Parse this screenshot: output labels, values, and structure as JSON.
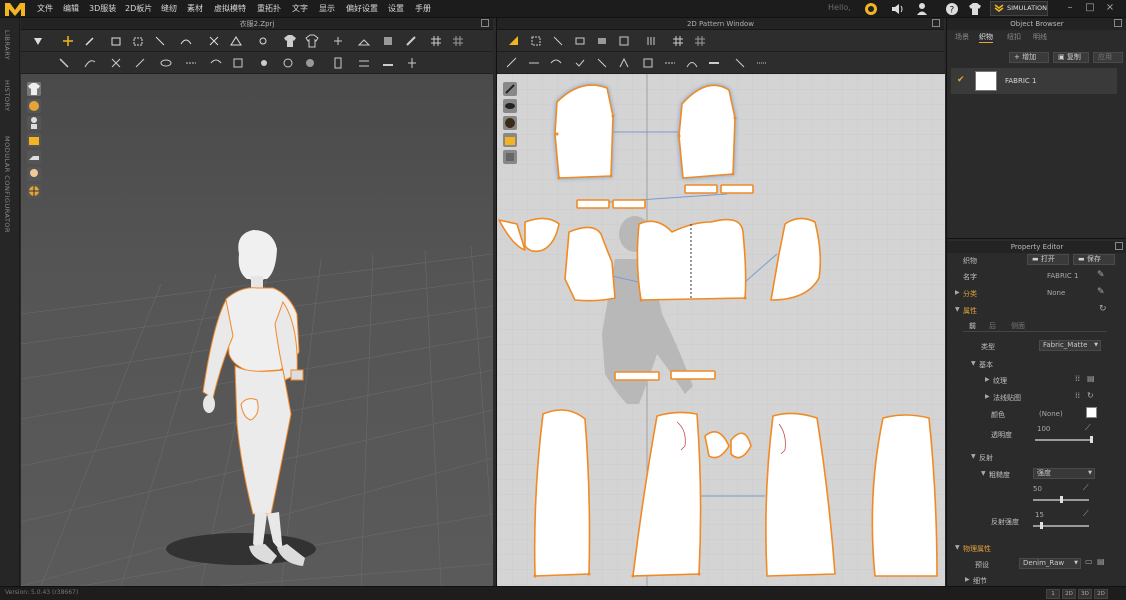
{
  "menubar": {
    "items": [
      "文件",
      "编辑",
      "3D服装",
      "2D板片",
      "缝纫",
      "素材",
      "虚拟模特",
      "重拓扑",
      "文字",
      "显示",
      "偏好设置",
      "设置",
      "手册"
    ],
    "hello": "Hello,",
    "simulation_label": "SIMULATION"
  },
  "sidestrip": {
    "labels": [
      "LIBRARY",
      "HISTORY",
      "MODULAR CONFIGURATOR"
    ]
  },
  "panel3d": {
    "title": "衣服2.Zprj"
  },
  "panel2d": {
    "title": "2D Pattern Window"
  },
  "object_browser": {
    "title": "Object Browser",
    "tabs": [
      "场景",
      "织物",
      "纽扣",
      "明线"
    ],
    "active_tab": "织物",
    "add_label": "增加",
    "copy_label": "复制",
    "apply_label": "应用",
    "fabric_name": "FABRIC 1"
  },
  "property_editor": {
    "title": "Property Editor",
    "header": "织物",
    "open_label": "打开",
    "save_label": "保存",
    "name_label": "名字",
    "name_value": "FABRIC 1",
    "category_label": "分类",
    "category_value": "None",
    "attributes_label": "属性",
    "subtabs": [
      "前",
      "后",
      "侧面"
    ],
    "type_label": "类型",
    "type_value": "Fabric_Matte",
    "basic_label": "基本",
    "texture_label": "纹理",
    "normal_label": "法线贴图",
    "color_label": "颜色",
    "color_value": "(None)",
    "opacity_label": "透明度",
    "opacity_value": "100",
    "opacity_level": 1.0,
    "reflection_label": "反射",
    "roughness_label": "粗糙度",
    "roughness_type": "强度",
    "roughness_value": "50",
    "roughness_level": 0.5,
    "reflect_strength_label": "反射强度",
    "reflect_strength_value": "15",
    "reflect_strength_level": 0.15,
    "physical_label": "物理属性",
    "preset_label": "预设",
    "preset_value": "Denim_Raw",
    "detail_label": "细节"
  },
  "statusbar": {
    "version": "Version: 5.0.43 (r38667)",
    "buttons": [
      "1",
      "2D",
      "3D",
      "2D"
    ]
  },
  "colors": {
    "accent": "#e4a43a",
    "pattern_outline": "#f08a24",
    "seam_line": "#7aa0d0"
  }
}
